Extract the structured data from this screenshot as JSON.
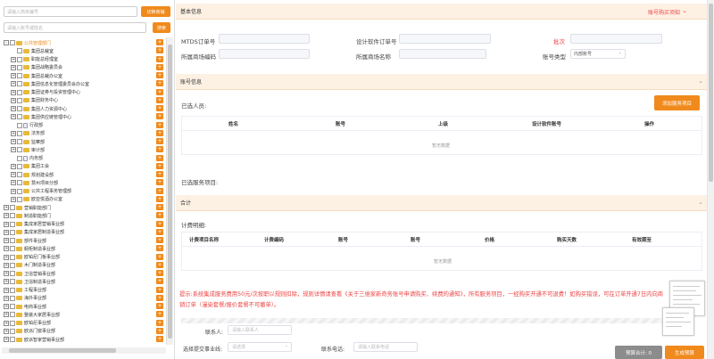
{
  "left": {
    "order_search_placeholder": "请输入简单编号",
    "switch_button": "切换商铺",
    "account_search_placeholder": "请输入账号或姓名",
    "search_button": "搜索",
    "tree": [
      {
        "label": "公共管理部门",
        "level": 0,
        "pm": "-",
        "selected": true,
        "icon": "folder"
      },
      {
        "label": "集团总裁室",
        "level": 1,
        "pm": "",
        "icon": "folder"
      },
      {
        "label": "职能总经理室",
        "level": 1,
        "pm": "+",
        "icon": "folder"
      },
      {
        "label": "集团战略委员会",
        "level": 1,
        "pm": "+",
        "icon": "folder"
      },
      {
        "label": "集团总裁办公室",
        "level": 1,
        "pm": "+",
        "icon": "folder"
      },
      {
        "label": "集团信息化管理委员会办公室",
        "level": 1,
        "pm": "+",
        "icon": "folder"
      },
      {
        "label": "集团证券与投资管理中心",
        "level": 1,
        "pm": "+",
        "icon": "folder"
      },
      {
        "label": "集团财务中心",
        "level": 1,
        "pm": "+",
        "icon": "folder"
      },
      {
        "label": "集团人力资源中心",
        "level": 1,
        "pm": "+",
        "icon": "folder"
      },
      {
        "label": "集团供应链管理中心",
        "level": 1,
        "pm": "+",
        "icon": "folder"
      },
      {
        "label": "行政部",
        "level": 1,
        "pm": "",
        "icon": "file"
      },
      {
        "label": "法务部",
        "level": 1,
        "pm": "+",
        "icon": "folder"
      },
      {
        "label": "监察部",
        "level": 1,
        "pm": "+",
        "icon": "folder"
      },
      {
        "label": "审计部",
        "level": 1,
        "pm": "+",
        "icon": "folder"
      },
      {
        "label": "内务部",
        "level": 1,
        "pm": "",
        "icon": "file"
      },
      {
        "label": "集团工会",
        "level": 1,
        "pm": "+",
        "icon": "folder"
      },
      {
        "label": "规划建设部",
        "level": 1,
        "pm": "+",
        "icon": "folder"
      },
      {
        "label": "慧州项目分部",
        "level": 1,
        "pm": "+",
        "icon": "folder"
      },
      {
        "label": "公共工程事务管理部",
        "level": 1,
        "pm": "+",
        "icon": "folder"
      },
      {
        "label": "欧亚悦酒办公室",
        "level": 1,
        "pm": "+",
        "icon": "folder"
      },
      {
        "label": "营销职能部门",
        "level": 0,
        "pm": "+",
        "icon": "folder"
      },
      {
        "label": "制造职能部门",
        "level": 0,
        "pm": "+",
        "icon": "folder"
      },
      {
        "label": "集成家居营销事业部",
        "level": 0,
        "pm": "+",
        "icon": "folder"
      },
      {
        "label": "集成家居制造事业部",
        "level": 0,
        "pm": "+",
        "icon": "folder"
      },
      {
        "label": "部件事业部",
        "level": 0,
        "pm": "+",
        "icon": "folder"
      },
      {
        "label": "橱柜制造事业部",
        "level": 0,
        "pm": "+",
        "icon": "folder"
      },
      {
        "label": "欧铂尼门板事业部",
        "level": 0,
        "pm": "+",
        "icon": "folder"
      },
      {
        "label": "木门制造事业部",
        "level": 0,
        "pm": "+",
        "icon": "folder"
      },
      {
        "label": "卫浴营销事业部",
        "level": 0,
        "pm": "+",
        "icon": "folder"
      },
      {
        "label": "卫浴制造事业部",
        "level": 0,
        "pm": "+",
        "icon": "folder"
      },
      {
        "label": "工程事业部",
        "level": 0,
        "pm": "+",
        "icon": "folder"
      },
      {
        "label": "海外事业部",
        "level": 0,
        "pm": "+",
        "icon": "folder"
      },
      {
        "label": "电商事业部",
        "level": 0,
        "pm": "+",
        "icon": "folder"
      },
      {
        "label": "整装大家居事业部",
        "level": 0,
        "pm": "+",
        "icon": "folder"
      },
      {
        "label": "欧铂尼事业部",
        "level": 0,
        "pm": "+",
        "icon": "folder"
      },
      {
        "label": "欧派门窗事业部",
        "level": 0,
        "pm": "+",
        "icon": "folder"
      },
      {
        "label": "欧派智家营销事业部",
        "level": 0,
        "pm": "+",
        "icon": "folder"
      }
    ]
  },
  "basic": {
    "section_title": "基本信息",
    "notice_link": "账号购买须知",
    "mtds_label": "MTDS订单号",
    "design_order_label": "设计软件订单号",
    "batch_label": "批次",
    "store_code_label": "所属商场编码",
    "store_name_label": "所属商场名称",
    "account_type_label": "账号类型",
    "account_type_value": "内部账号"
  },
  "account": {
    "section_title": "账号信息",
    "selected_people_label": "已选人员:",
    "add_button": "添加服务项目",
    "columns": [
      "姓名",
      "账号",
      "上级",
      "设计软件账号",
      "操作"
    ],
    "empty_text": "暂无数据",
    "selected_services_label": "已选服务项目:"
  },
  "total": {
    "section_title": "合计",
    "detail_label": "计费明细:",
    "columns": [
      "计费项目名称",
      "计费编码",
      "账号",
      "账号",
      "价格",
      "购买天数",
      "有效期至"
    ],
    "empty_text": "暂无数据"
  },
  "tip": {
    "line1": "提示:系统集成服务费用50元/次按职以规则扣除，规则详情请查看《关于三维家新奇务账号申请购买、续费的通知》，所有服务项目，一经购买开通不可退费！如购买错误，可在订单开通7日内向商",
    "line2": "销订单（漫染套餐/报价套餐不可撤单）。"
  },
  "footer": {
    "contact_label": "联系人:",
    "contact_placeholder": "请输入联系人",
    "submit_dept_label": "选择提交事业线:",
    "submit_dept_placeholder": "请选择",
    "phone_label": "联系电话:",
    "phone_placeholder": "请输入联系电话",
    "budget_button": "预算合计: 0",
    "generate_button": "生成预算"
  }
}
